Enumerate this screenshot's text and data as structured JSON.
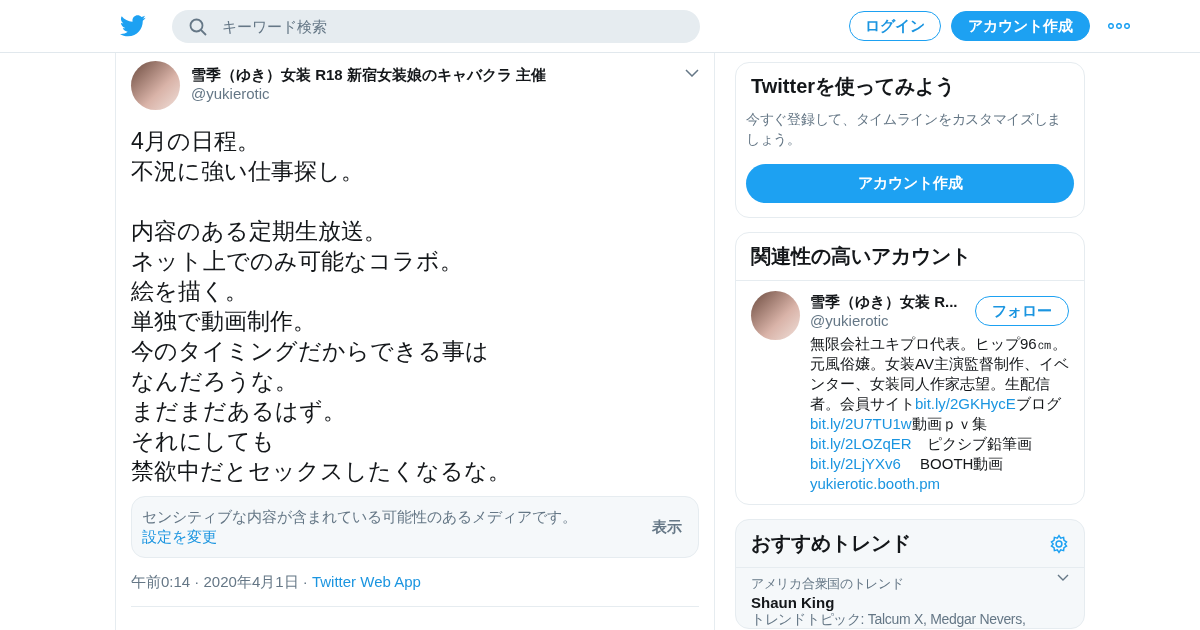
{
  "header": {
    "search": {
      "placeholder": "キーワード検索"
    },
    "login": "ログイン",
    "signup": "アカウント作成"
  },
  "tweet": {
    "name": "雪季（ゆき）女装 R18 新宿女装娘のキャバクラ 主催",
    "handle": "@yukierotic",
    "paragraphs": [
      [
        "4月の日程。",
        "不況に強い仕事探し。"
      ],
      [
        "内容のある定期生放送。",
        "ネット上でのみ可能なコラボ。",
        "絵を描く。",
        "単独で動画制作。",
        "今のタイミングだからできる事は",
        "なんだろうな。",
        "まだまだあるはず。",
        "それにしても",
        "禁欲中だとセックスしたくなるな。"
      ]
    ],
    "sensitive": {
      "text": "センシティブな内容が含まれている可能性のあるメディアです。",
      "link": "設定を変更",
      "show": "表示"
    },
    "time": "午前0:14 · 2020年4月1日",
    "separator": "·",
    "source": "Twitter Web App"
  },
  "join": {
    "title": "Twitterを使ってみよう",
    "text": "今すぐ登録して、タイムラインをカスタマイズしましょう。",
    "button": "アカウント作成"
  },
  "related": {
    "title": "関連性の高いアカウント",
    "name": "雪季（ゆき）女装 R...",
    "handle": "@yukierotic",
    "follow": "フォロー",
    "bio": [
      {
        "kind": "text",
        "text": "無限会社ユキプロ代表。ヒップ96㎝。元風俗嬢。女装AV主演監督制作、イベンター、女装同人作家志望。生配信者。会員サイト"
      },
      {
        "kind": "link",
        "text": "bit.ly/2GKHycE"
      },
      {
        "kind": "text",
        "text": "ブログ"
      },
      {
        "kind": "link",
        "text": "bit.ly/2U7TU1w"
      },
      {
        "kind": "text",
        "text": "動画ｐｖ集"
      },
      {
        "kind": "link",
        "text": "bit.ly/2LOZqER"
      },
      {
        "kind": "text",
        "text": "　ピクシブ鉛筆画"
      },
      {
        "kind": "link",
        "text": "bit.ly/2LjYXv6"
      },
      {
        "kind": "text",
        "text": "　 BOOTH動画　"
      },
      {
        "kind": "link",
        "text": "yukierotic.booth.pm"
      }
    ]
  },
  "trends": {
    "title": "おすすめトレンド",
    "items": [
      {
        "context": "アメリカ合衆国のトレンド",
        "name": "Shaun King",
        "topic": "トレンドトピック: Talcum X, Medgar Nevers,"
      }
    ]
  }
}
